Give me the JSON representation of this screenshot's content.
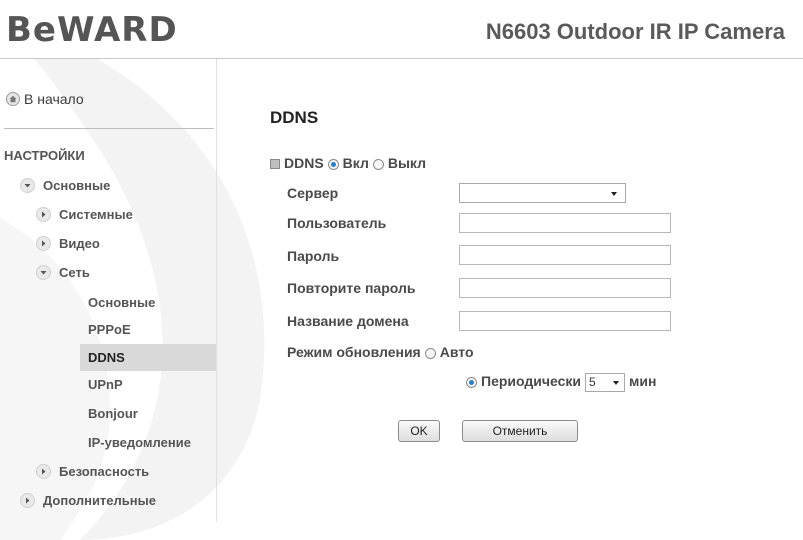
{
  "header": {
    "logo": "BeWARD",
    "model": "N6603 Outdoor IR IP Camera"
  },
  "sidebar": {
    "home_label": "В начало",
    "section_title": "НАСТРОЙКИ",
    "items": [
      {
        "label": "Основные",
        "state": "expanded"
      },
      {
        "label": "Системные",
        "state": "collapsed"
      },
      {
        "label": "Видео",
        "state": "collapsed"
      },
      {
        "label": "Сеть",
        "state": "expanded"
      },
      {
        "label": "Основные"
      },
      {
        "label": "PPPoE"
      },
      {
        "label": "DDNS",
        "active": true
      },
      {
        "label": "UPnP"
      },
      {
        "label": "Bonjour"
      },
      {
        "label": "IP-уведомление"
      },
      {
        "label": "Безопасность",
        "state": "collapsed"
      },
      {
        "label": "Дополнительные",
        "state": "collapsed"
      }
    ]
  },
  "main": {
    "title": "DDNS",
    "ddns": {
      "label": "DDNS",
      "on_label": "Вкл",
      "off_label": "Выкл",
      "selected": "on"
    },
    "fields": {
      "server_label": "Сервер",
      "server_value": "",
      "user_label": "Пользователь",
      "user_value": "",
      "password_label": "Пароль",
      "password_value": "",
      "password_repeat_label": "Повторите пароль",
      "password_repeat_value": "",
      "domain_label": "Название домена",
      "domain_value": ""
    },
    "update": {
      "label": "Режим обновления",
      "auto_label": "Авто",
      "periodic_label": "Периодически",
      "interval_value": "5",
      "interval_unit": "мин",
      "selected": "periodic"
    },
    "buttons": {
      "ok": "OK",
      "cancel": "Отменить"
    }
  },
  "colors": {
    "active_bg": "#d9d9d9",
    "radio_dot": "#2e7fbf",
    "text": "#4a4a4a"
  }
}
